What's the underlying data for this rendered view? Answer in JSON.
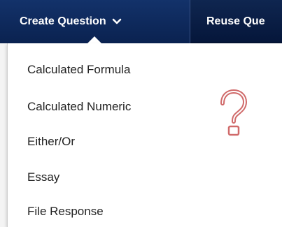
{
  "toolbar": {
    "create_label": "Create Question",
    "reuse_label": "Reuse Que"
  },
  "menu": {
    "items": [
      {
        "label": "Calculated Formula"
      },
      {
        "label": "Calculated Numeric"
      },
      {
        "label": "Either/Or"
      },
      {
        "label": "Essay"
      },
      {
        "label": "File Response"
      }
    ]
  },
  "colors": {
    "toolbar_bg": "#0b1f48",
    "menu_bg": "#ffffff",
    "accent_question": "#d06a6a"
  },
  "icons": {
    "dropdown": "chevron-down-icon",
    "question": "question-mark-icon"
  }
}
